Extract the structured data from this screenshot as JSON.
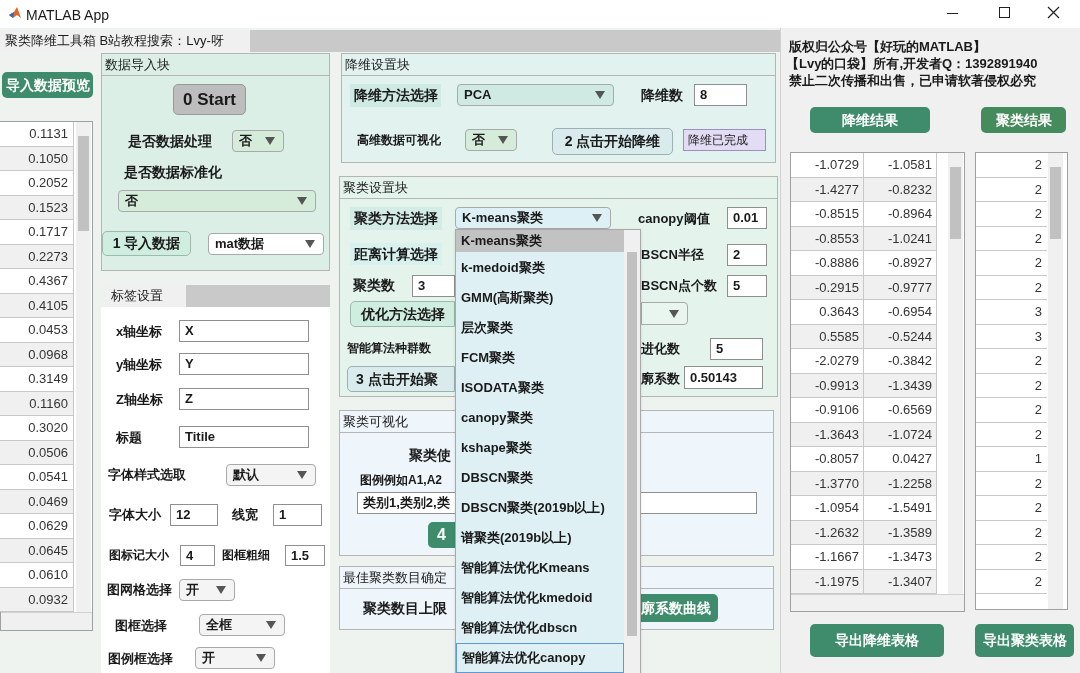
{
  "window": {
    "title": "MATLAB App"
  },
  "tabs": [
    {
      "label": "聚类降维工具箱 B站教程搜索：Lvy-呀",
      "selected": true
    }
  ],
  "preview_button": "导入数据预览",
  "preview_table": {
    "rows": [
      "0.1131",
      "0.1050",
      "0.2052",
      "0.1523",
      "0.1717",
      "0.2273",
      "0.4367",
      "0.4105",
      "0.0453",
      "0.0968",
      "0.3149",
      "0.1160",
      "0.3020",
      "0.0506",
      "0.0541",
      "0.0469",
      "0.0629",
      "0.0645",
      "0.0610",
      "0.0932"
    ]
  },
  "import_panel": {
    "title": "数据导入块",
    "start_button": "0 Start",
    "process": {
      "label": "是否数据处理",
      "value": "否"
    },
    "normalize": {
      "label": "是否数据标准化",
      "value": "否"
    },
    "import_button": "1 导入数据",
    "format": {
      "value": "mat数据"
    }
  },
  "label_panel": {
    "tab": {
      "label": "标签设置",
      "selected": true
    },
    "axis_fields": [
      {
        "label": "x轴坐标",
        "value": "X"
      },
      {
        "label": "y轴坐标",
        "value": "Y"
      },
      {
        "label": "Z轴坐标",
        "value": "Z"
      },
      {
        "label": "标题",
        "value": "Titile"
      }
    ],
    "font_style": {
      "label": "字体样式选取",
      "value": "默认"
    },
    "font_size": {
      "label": "字体大小",
      "value": "12"
    },
    "line_width": {
      "label": "线宽",
      "value": "1"
    },
    "marker_size": {
      "label": "图标记大小",
      "value": "4"
    },
    "frame_width": {
      "label": "图框粗细",
      "value": "1.5"
    },
    "grid": {
      "label": "图网格选择",
      "value": "开"
    },
    "frame": {
      "label": "图框选择",
      "value": "全框"
    },
    "legend_box": {
      "label": "图例框选择",
      "value": "开"
    }
  },
  "reduction_panel": {
    "title": "降维设置块",
    "method": {
      "label": "降维方法选择",
      "value": "PCA"
    },
    "dims": {
      "label": "降维数",
      "value": "8"
    },
    "visualize": {
      "label": "高维数据可视化",
      "value": "否"
    },
    "start_button": "2 点击开始降维",
    "status": "降维已完成"
  },
  "cluster_panel": {
    "title": "聚类设置块",
    "method": {
      "label": "聚类方法选择",
      "value": "K-means聚类"
    },
    "canopy": {
      "label": "canopy阈值",
      "value": "0.01"
    },
    "distance": {
      "label": "距离计算选择"
    },
    "radius": {
      "label": "BSCN半径",
      "value": "2"
    },
    "count": {
      "label": "聚类数",
      "value": "3"
    },
    "min_points": {
      "label": "BSCN点个数",
      "value": "5"
    },
    "optimize_button": "优化方法选择",
    "population": {
      "label": "智能算法种群数"
    },
    "generations": {
      "label": "进化数",
      "value": "5"
    },
    "start_button": "3 点击开始聚",
    "silhouette": {
      "label": "廓系数",
      "value": "0.50143"
    }
  },
  "visual_panel": {
    "title": "聚类可视化",
    "caption": "聚类使",
    "legend_label": "图例例如A1,A2",
    "legend_value": "类别1,类别2,类",
    "button": "4"
  },
  "best_k_panel": {
    "title": "最佳聚类数目确定",
    "label": "聚类数目上限",
    "button": "廓系数曲线"
  },
  "dropdown_list": {
    "items": [
      {
        "label": "K-means聚类",
        "selected": true,
        "focused": false
      },
      {
        "label": "k-medoid聚类",
        "selected": false,
        "focused": false
      },
      {
        "label": "GMM(高斯聚类)",
        "selected": false,
        "focused": false
      },
      {
        "label": "层次聚类",
        "selected": false,
        "focused": false
      },
      {
        "label": "FCM聚类",
        "selected": false,
        "focused": false
      },
      {
        "label": "ISODATA聚类",
        "selected": false,
        "focused": false
      },
      {
        "label": "canopy聚类",
        "selected": false,
        "focused": false
      },
      {
        "label": "kshape聚类",
        "selected": false,
        "focused": false
      },
      {
        "label": "DBSCN聚类",
        "selected": false,
        "focused": false
      },
      {
        "label": "DBSCN聚类(2019b以上)",
        "selected": false,
        "focused": false
      },
      {
        "label": "谱聚类(2019b以上)",
        "selected": false,
        "focused": false
      },
      {
        "label": "智能算法优化Kmeans",
        "selected": false,
        "focused": false
      },
      {
        "label": "智能算法优化kmedoid",
        "selected": false,
        "focused": false
      },
      {
        "label": "智能算法优化dbscn",
        "selected": false,
        "focused": false
      },
      {
        "label": "智能算法优化canopy",
        "selected": false,
        "focused": true
      }
    ]
  },
  "copyright": [
    "版权归公众号【好玩的MATLAB】",
    "【Lvy的口袋】所有,开发者Q：1392891940",
    "禁止二次传播和出售，已申请软著侵权必究"
  ],
  "reduction_button": "降维结果",
  "cluster_button": "聚类结果",
  "reduction_table": {
    "rows": [
      [
        "-1.0729",
        "-1.0581"
      ],
      [
        "-1.4277",
        "-0.8232"
      ],
      [
        "-0.8515",
        "-0.8964"
      ],
      [
        "-0.8553",
        "-1.0241"
      ],
      [
        "-0.8886",
        "-0.8927"
      ],
      [
        "-0.2915",
        "-0.9777"
      ],
      [
        "0.3643",
        "-0.6954"
      ],
      [
        "0.5585",
        "-0.5244"
      ],
      [
        "-2.0279",
        "-0.3842"
      ],
      [
        "-0.9913",
        "-1.3439"
      ],
      [
        "-0.9106",
        "-0.6569"
      ],
      [
        "-1.3643",
        "-1.0724"
      ],
      [
        "-0.8057",
        "0.0427"
      ],
      [
        "-1.3770",
        "-1.2258"
      ],
      [
        "-1.0954",
        "-1.5491"
      ],
      [
        "-1.2632",
        "-1.3589"
      ],
      [
        "-1.1667",
        "-1.3473"
      ],
      [
        "-1.1975",
        "-1.3407"
      ]
    ]
  },
  "cluster_table": {
    "rows": [
      "2",
      "2",
      "2",
      "2",
      "2",
      "2",
      "3",
      "3",
      "2",
      "2",
      "2",
      "2",
      "1",
      "2",
      "2",
      "2",
      "2",
      "2"
    ]
  },
  "export_buttons": [
    "导出降维表格",
    "导出聚类表格"
  ]
}
